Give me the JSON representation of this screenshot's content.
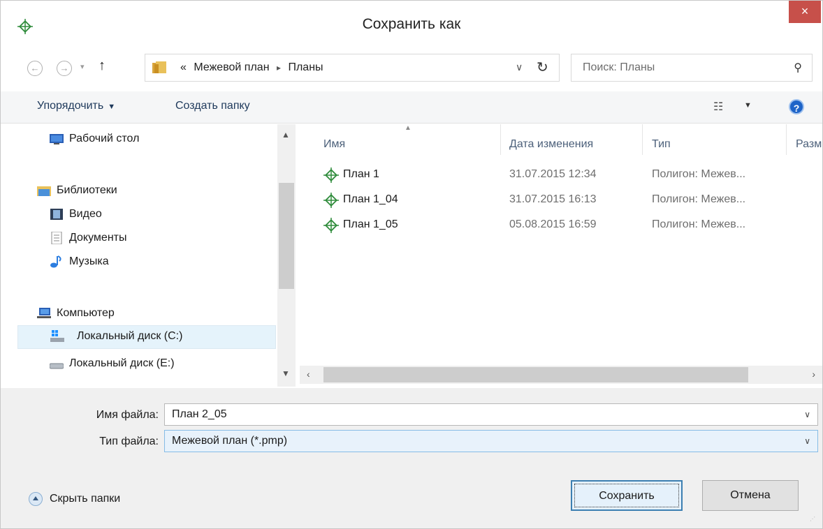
{
  "window": {
    "title": "Сохранить как",
    "close_label": "×"
  },
  "nav": {
    "back_icon": "arrow-left-circle-icon",
    "forward_icon": "arrow-right-circle-icon",
    "breadcrumb_prefix": "«",
    "breadcrumb": [
      "Межевой план",
      "Планы"
    ],
    "breadcrumb_sep": "▸",
    "dropdown_glyph": "∨",
    "refresh_glyph": "↻",
    "search_placeholder": "Поиск: Планы"
  },
  "toolbar": {
    "organize_label": "Упорядочить",
    "new_folder_label": "Создать папку",
    "help_label": "?"
  },
  "sidebar": {
    "items": [
      {
        "label": "Рабочий стол",
        "icon": "desktop-icon"
      },
      {
        "label": "Библиотеки",
        "icon": "library-icon"
      },
      {
        "label": "Видео",
        "icon": "video-icon"
      },
      {
        "label": "Документы",
        "icon": "documents-icon"
      },
      {
        "label": "Музыка",
        "icon": "music-icon"
      },
      {
        "label": "Компьютер",
        "icon": "computer-icon"
      },
      {
        "label": "Локальный диск (C:)",
        "icon": "drive-c-icon",
        "selected": true
      },
      {
        "label": "Локальный диск (E:)",
        "icon": "drive-e-icon"
      }
    ]
  },
  "files": {
    "columns": [
      "Имя",
      "Дата изменения",
      "Тип",
      "Разм"
    ],
    "rows": [
      {
        "name": "План 1",
        "date": "31.07.2015 12:34",
        "type": "Полигон: Межев..."
      },
      {
        "name": "План 1_04",
        "date": "31.07.2015 16:13",
        "type": "Полигон: Межев..."
      },
      {
        "name": "План 1_05",
        "date": "05.08.2015 16:59",
        "type": "Полигон: Межев..."
      }
    ]
  },
  "form": {
    "filename_label": "Имя файла:",
    "filename_value": "План 2_05",
    "filetype_label": "Тип файла:",
    "filetype_value": "Межевой план (*.pmp)"
  },
  "footer": {
    "hide_folders_label": "Скрыть папки",
    "save_label": "Сохранить",
    "cancel_label": "Отмена"
  },
  "colors": {
    "accent": "#3c7fb1",
    "close": "#c7504a",
    "app_icon": "#2e8b3a"
  }
}
